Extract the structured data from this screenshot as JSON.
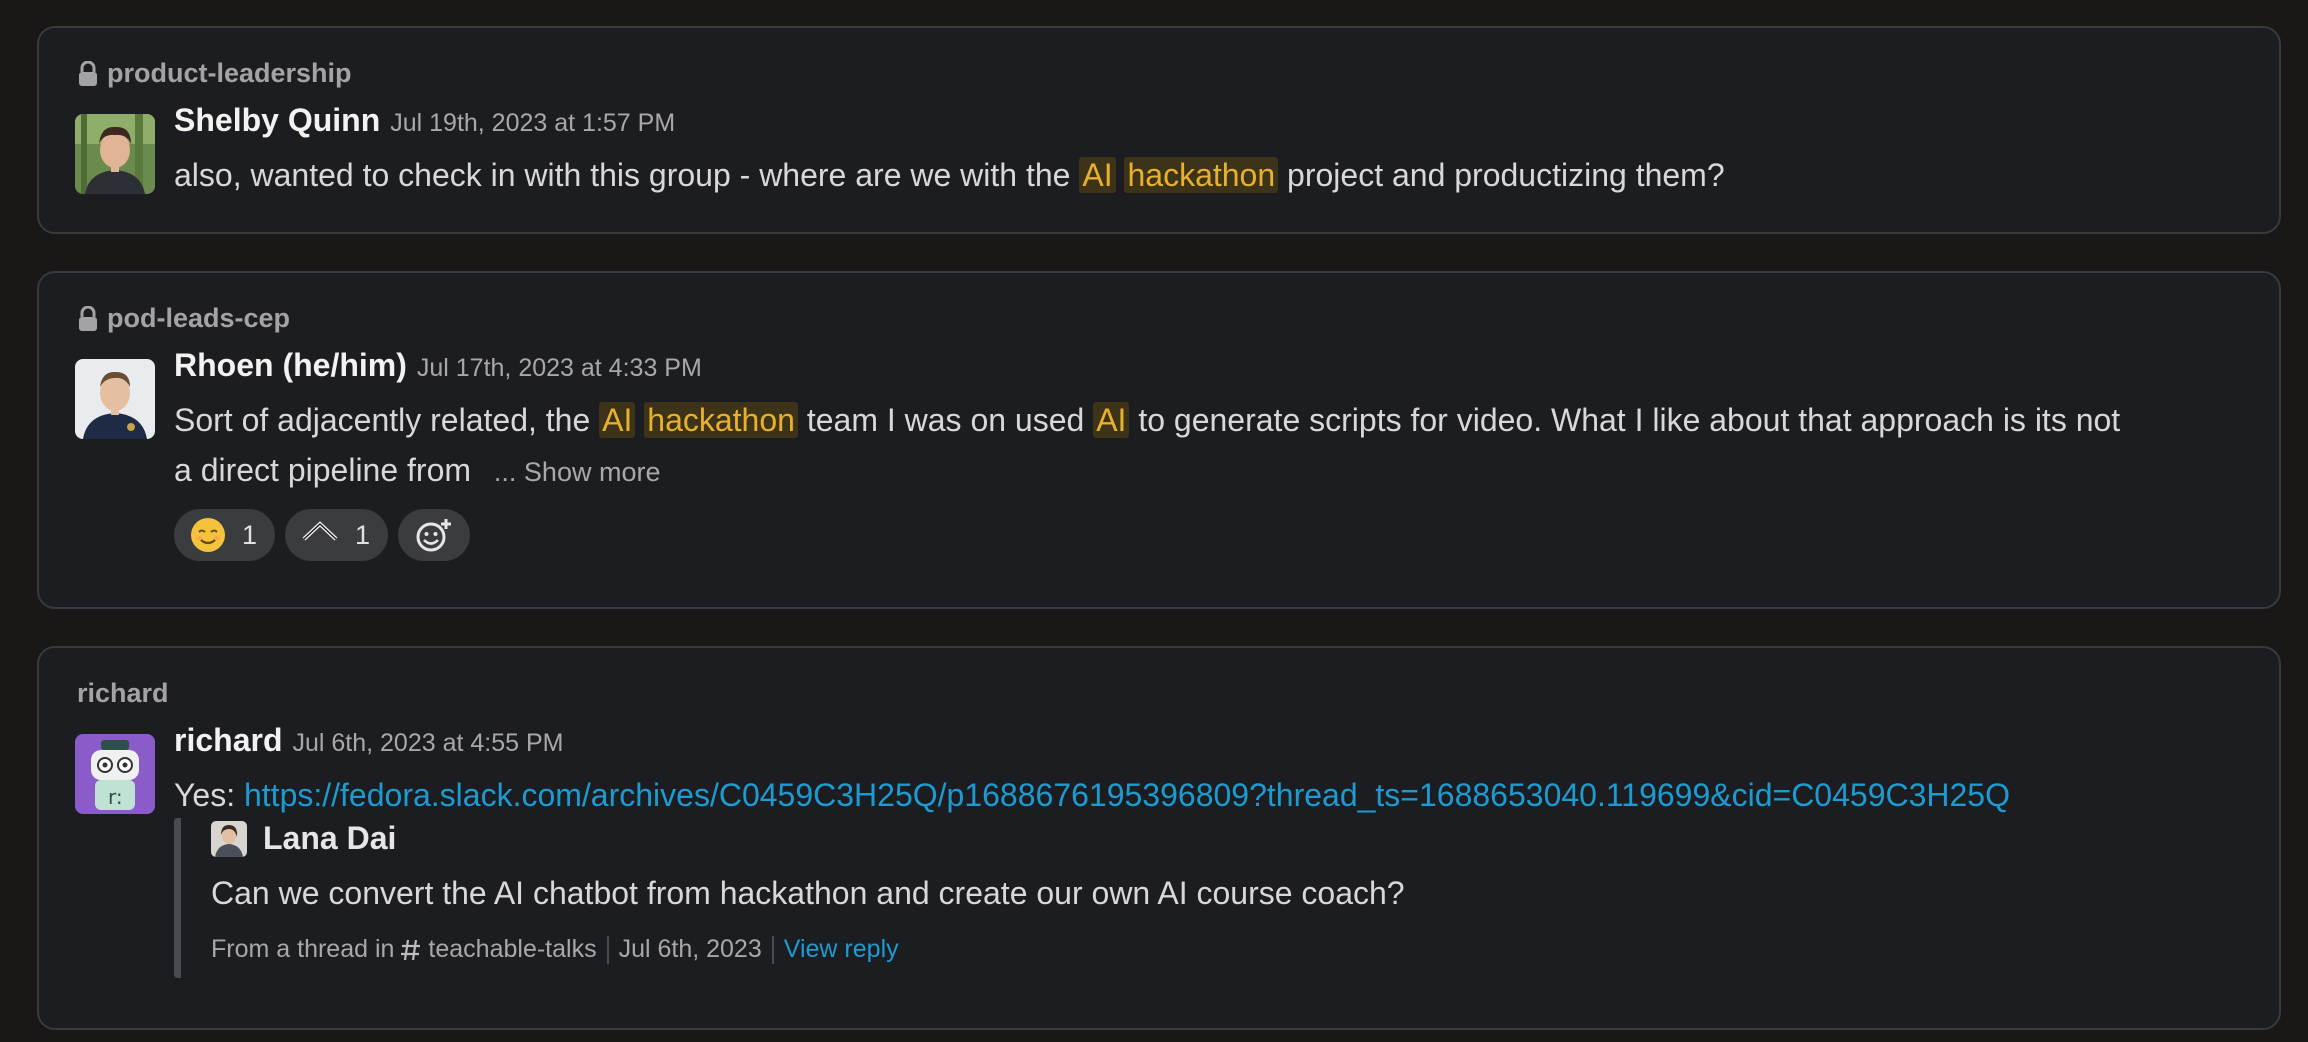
{
  "results": [
    {
      "channel": "product-leadership",
      "author": "Shelby Quinn",
      "timestamp": "Jul 19th, 2023 at 1:57 PM",
      "text_before": "also, wanted to check in with this group - where are we with the ",
      "hl1": "AI",
      "hl2": "hackathon",
      "text_after": " project and productizing them?"
    },
    {
      "channel": "pod-leads-cep",
      "author": "Rhoen (he/him)",
      "timestamp": "Jul 17th, 2023 at 4:33 PM",
      "line1_a": "Sort of adjacently related, the ",
      "hl1": "AI",
      "hl2": "hackathon",
      "line1_b": " team I was on used ",
      "hl3": "AI",
      "line1_c": " to generate scripts for video. What I like about that approach is its not",
      "line2": "a direct pipeline from ",
      "show_more": "... Show more",
      "reactions": [
        {
          "emoji": "relieved-face",
          "count": "1"
        },
        {
          "emoji": "chevron-up",
          "count": "1"
        }
      ]
    },
    {
      "channel": "richard",
      "author": "richard",
      "timestamp": "Jul 6th, 2023 at 4:55 PM",
      "prefix": "Yes: ",
      "link": "https://fedora.slack.com/archives/C0459C3H25Q/p1688676195396809?thread_ts=1688653040.119699&cid=C0459C3H25Q",
      "quote": {
        "author": "Lana Dai",
        "text": "Can we convert the AI chatbot from hackathon and create our own AI course coach?",
        "from_thread": "From a thread in",
        "channel": "teachable-talks",
        "date": "Jul 6th, 2023",
        "view_reply": "View reply"
      }
    }
  ],
  "colors": {
    "highlight": "#e8b12c",
    "link": "#1d9bd1",
    "card_bg": "#1c1d21"
  }
}
